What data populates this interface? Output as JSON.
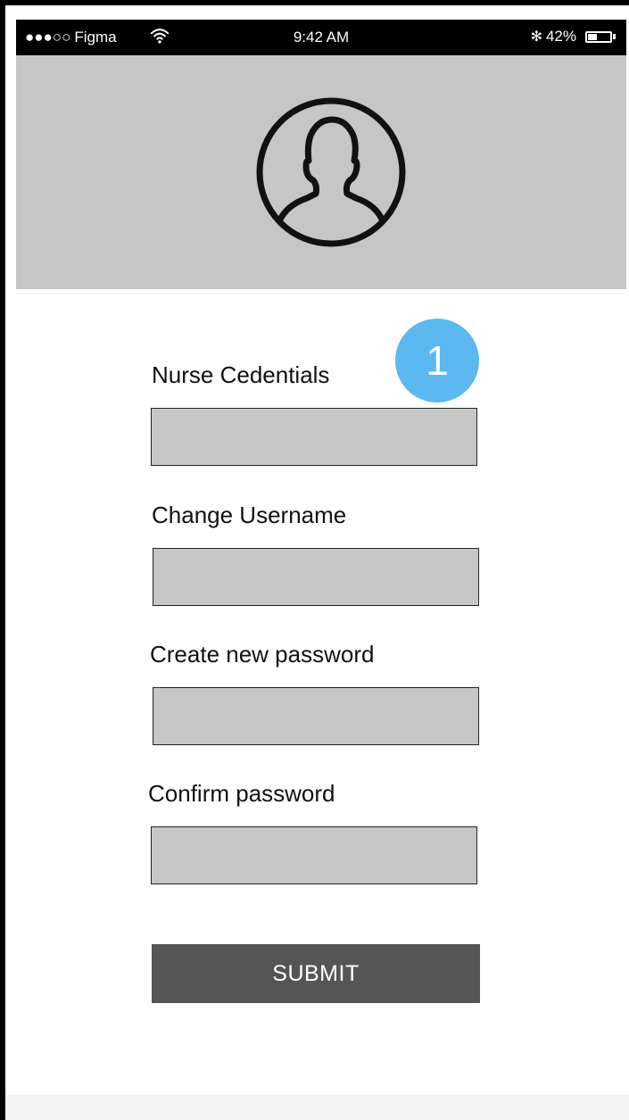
{
  "status_bar": {
    "signal_dots": "●●●○○",
    "carrier": "Figma",
    "time": "9:42 AM",
    "bluetooth": "✻",
    "battery_percent": "42%",
    "battery_level": 0.42,
    "wifi_icon": "wifi-icon"
  },
  "header": {
    "avatar_icon": "user-avatar-icon",
    "background_color": "#c6c6c6"
  },
  "step_badge": {
    "number": "1",
    "color": "#5bb8f0"
  },
  "form": {
    "fields": [
      {
        "label": "Nurse Cedentials",
        "value": "",
        "placeholder": ""
      },
      {
        "label": "Change Username",
        "value": "",
        "placeholder": ""
      },
      {
        "label": "Create new password",
        "value": "",
        "placeholder": ""
      },
      {
        "label": "Confirm password",
        "value": "",
        "placeholder": ""
      }
    ],
    "submit_label": "SUBMIT"
  }
}
